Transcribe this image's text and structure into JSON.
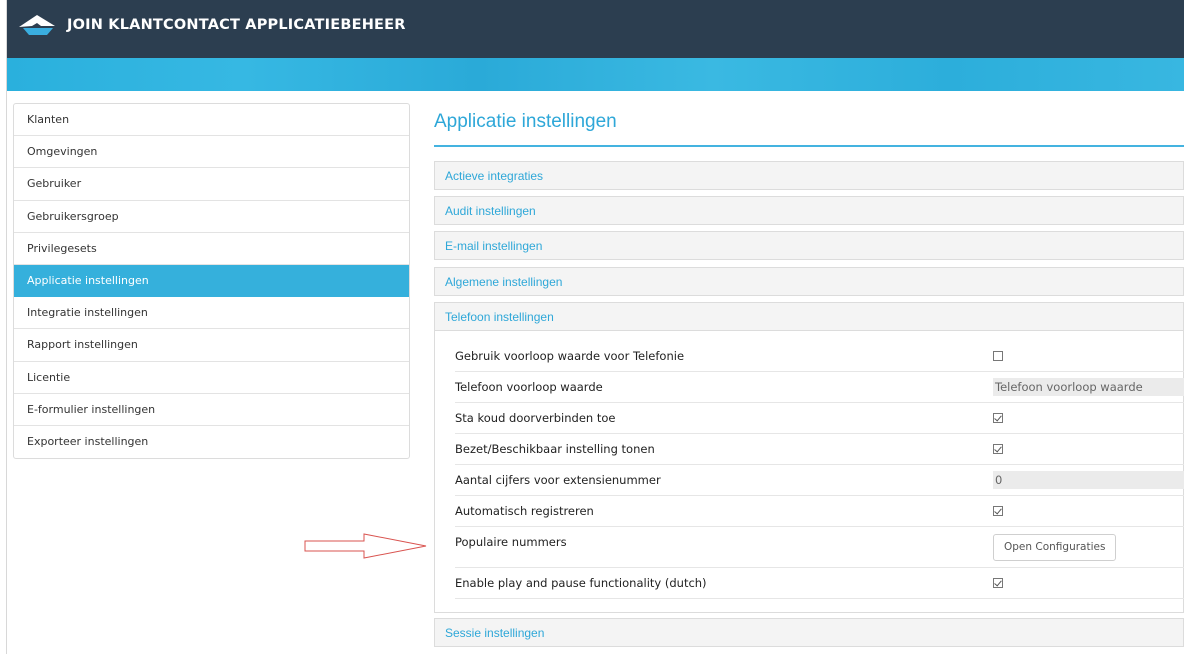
{
  "app": {
    "title": "JOIN KLANTCONTACT APPLICATIEBEHEER",
    "logo_icon": "join-logo-icon"
  },
  "colors": {
    "topbar": "#2c3e50",
    "accent": "#35b0dc",
    "link": "#2ea7d8"
  },
  "sidebar": {
    "items": [
      {
        "label": "Klanten"
      },
      {
        "label": "Omgevingen"
      },
      {
        "label": "Gebruiker"
      },
      {
        "label": "Gebruikersgroep"
      },
      {
        "label": "Privilegesets"
      },
      {
        "label": "Applicatie instellingen",
        "active": true
      },
      {
        "label": "Integratie instellingen"
      },
      {
        "label": "Rapport instellingen"
      },
      {
        "label": "Licentie"
      },
      {
        "label": "E-formulier instellingen"
      },
      {
        "label": "Exporteer instellingen"
      }
    ]
  },
  "main": {
    "title": "Applicatie instellingen",
    "panels": [
      {
        "label": "Actieve integraties"
      },
      {
        "label": "Audit instellingen"
      },
      {
        "label": "E-mail instellingen"
      },
      {
        "label": "Algemene instellingen"
      },
      {
        "label": "Telefoon instellingen",
        "expanded": true
      },
      {
        "label": "Sessie instellingen"
      }
    ],
    "telefoon_rows": [
      {
        "label": "Gebruik voorloop waarde voor Telefonie",
        "type": "checkbox",
        "checked": false
      },
      {
        "label": "Telefoon voorloop waarde",
        "type": "text",
        "placeholder": "Telefoon voorloop waarde"
      },
      {
        "label": "Sta koud doorverbinden toe",
        "type": "checkbox",
        "checked": true
      },
      {
        "label": "Bezet/Beschikbaar instelling tonen",
        "type": "checkbox",
        "checked": true
      },
      {
        "label": "Aantal cijfers voor extensienummer",
        "type": "number",
        "value": "0"
      },
      {
        "label": "Automatisch registreren",
        "type": "checkbox",
        "checked": true
      },
      {
        "label": "Populaire nummers",
        "type": "button",
        "button_label": "Open Configuraties"
      },
      {
        "label": "Enable play and pause functionality (dutch)",
        "type": "checkbox",
        "checked": true
      }
    ]
  },
  "annotation": {
    "icon": "arrow-right-icon"
  }
}
